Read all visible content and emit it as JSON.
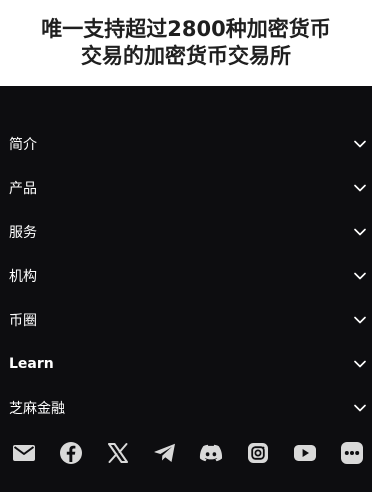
{
  "hero": {
    "title_line1": "唯一支持超过2800种加密货币",
    "title_line2": "交易的加密货币交易所"
  },
  "menu": {
    "items": [
      {
        "label": "简介",
        "icon": "chevron-down-icon"
      },
      {
        "label": "产品",
        "icon": "chevron-down-icon"
      },
      {
        "label": "服务",
        "icon": "chevron-down-icon"
      },
      {
        "label": "机构",
        "icon": "chevron-down-icon"
      },
      {
        "label": "币圈",
        "icon": "chevron-down-icon"
      },
      {
        "label": "Learn",
        "icon": "chevron-down-icon"
      },
      {
        "label": "芝麻金融",
        "icon": "chevron-down-icon"
      }
    ]
  },
  "social": {
    "icons": [
      "mail-icon",
      "facebook-icon",
      "x-icon",
      "telegram-icon",
      "discord-icon",
      "instagram-icon",
      "youtube-icon",
      "more-icon"
    ]
  },
  "colors": {
    "footer_bg": "#0d0d10",
    "icon_gray": "#d9d9d9",
    "text_white": "#ffffff",
    "title_dark": "#1f1f1f"
  }
}
